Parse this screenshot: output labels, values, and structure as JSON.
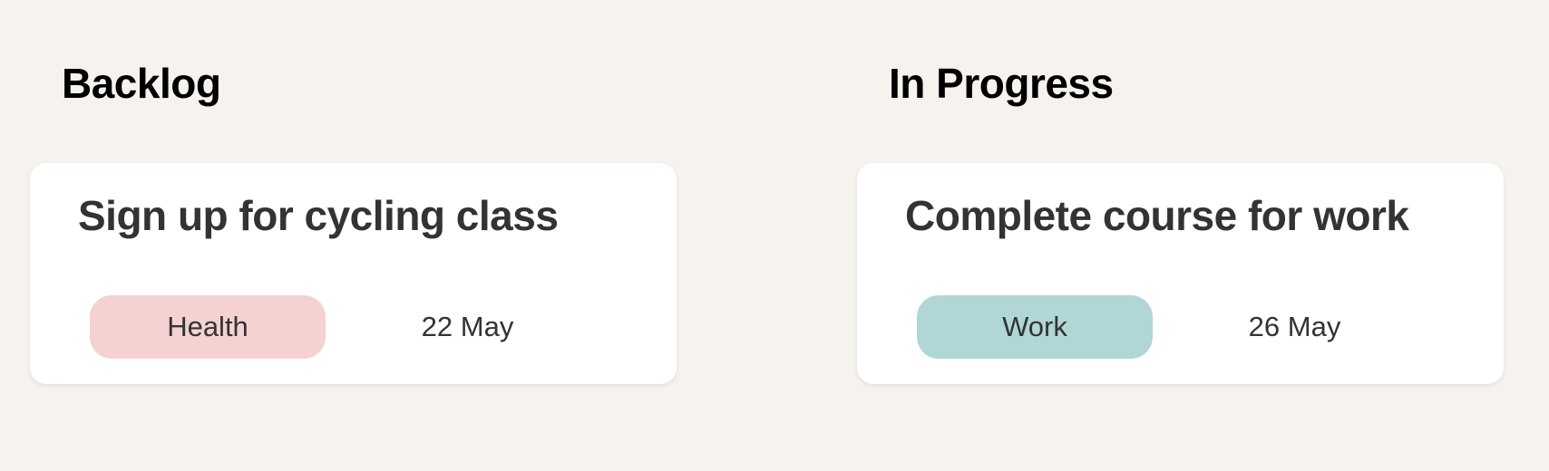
{
  "columns": [
    {
      "title": "Backlog",
      "cards": [
        {
          "title": "Sign up for cycling class",
          "tag": "Health",
          "tag_color": "#f4d2d2",
          "date": "22 May"
        }
      ]
    },
    {
      "title": "In Progress",
      "cards": [
        {
          "title": "Complete course for work",
          "tag": "Work",
          "tag_color": "#b0d6d6",
          "date": "26 May"
        }
      ]
    }
  ]
}
